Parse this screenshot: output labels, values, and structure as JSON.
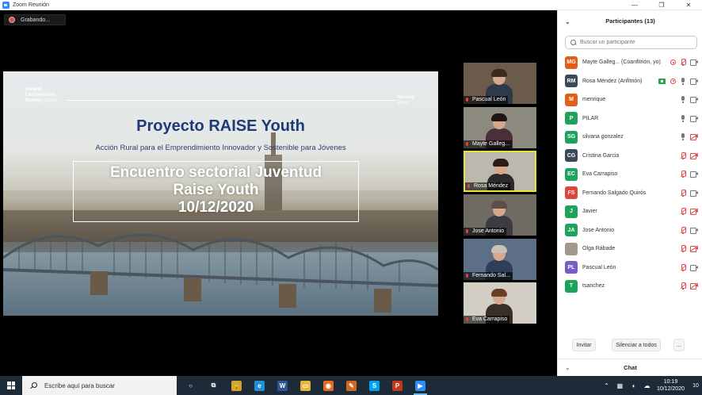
{
  "window": {
    "title": "Zoom Reunión",
    "controls": [
      "—",
      "❐",
      "✕"
    ]
  },
  "recording": {
    "label": "Grabando..."
  },
  "slide": {
    "logo_left": [
      "Iceland",
      "Liechtenstein",
      "Norway"
    ],
    "logo_left_grants": "grants",
    "logo_right": "Norway",
    "logo_right_grants": "grants",
    "title": "Proyecto RAISE Youth",
    "subtitle": "Acción Rural para el Emprendimiento Innovador y Sostenible para Jóvenes",
    "box_lines": [
      "Encuentro sectorial Juventud",
      "Raise Youth",
      "10/12/2020"
    ]
  },
  "videos": [
    {
      "name": "Pascual León",
      "bg": "#6b5b4a",
      "hair": "#3b2a1e",
      "shirt": "#2e3a4a",
      "active": false
    },
    {
      "name": "Mayte Galleg...",
      "bg": "#8d8a80",
      "hair": "#1e1410",
      "shirt": "#4a2f3a",
      "active": false
    },
    {
      "name": "Rosa Méndez",
      "bg": "#bdb8ae",
      "hair": "#2a1c14",
      "shirt": "#2a2a2a",
      "active": true
    },
    {
      "name": "Jose Antonio",
      "bg": "#6f6a62",
      "hair": "#5a5048",
      "shirt": "#3b3b40",
      "active": false
    },
    {
      "name": "Fernando Sal...",
      "bg": "#5c6f86",
      "hair": "#c8c2b8",
      "shirt": "#2f3f5a",
      "active": false
    },
    {
      "name": "Eva Carrapiso",
      "bg": "#d4cfc4",
      "hair": "#6a3e24",
      "shirt": "#3a2e2a",
      "active": false
    }
  ],
  "panel": {
    "title": "Participantes (13)",
    "search_placeholder": "Buscar un participante",
    "participants": [
      {
        "initials": "MG",
        "color": "#e25f1a",
        "name": "Mayte Galleg...",
        "role": "(Coanfitrión, yo)",
        "share": false,
        "rec": true,
        "mic": "muted",
        "cam": "on"
      },
      {
        "initials": "RM",
        "color": "#3a4a5c",
        "name": "Rosa Méndez (Anfitrión)",
        "role": "",
        "share": true,
        "rec": true,
        "mic": "on",
        "cam": "on"
      },
      {
        "initials": "M",
        "color": "#e25f1a",
        "name": "menrique",
        "role": "",
        "share": false,
        "rec": false,
        "mic": "on",
        "cam": "on"
      },
      {
        "initials": "P",
        "color": "#1ea35c",
        "name": "PILAR",
        "role": "",
        "share": false,
        "rec": false,
        "mic": "on",
        "cam": "on"
      },
      {
        "initials": "SG",
        "color": "#1ea35c",
        "name": "silvana gonzalez",
        "role": "",
        "share": false,
        "rec": false,
        "mic": "on",
        "cam": "off"
      },
      {
        "initials": "CG",
        "color": "#3a4a5c",
        "name": "Cristina Garcia",
        "role": "",
        "share": false,
        "rec": false,
        "mic": "muted",
        "cam": "off"
      },
      {
        "initials": "EC",
        "color": "#1ea35c",
        "name": "Eva Carrapiso",
        "role": "",
        "share": false,
        "rec": false,
        "mic": "muted",
        "cam": "on"
      },
      {
        "initials": "FS",
        "color": "#e0453a",
        "name": "Fernando Salgado Quirós",
        "role": "",
        "share": false,
        "rec": false,
        "mic": "muted",
        "cam": "on"
      },
      {
        "initials": "J",
        "color": "#1ea35c",
        "name": "Javier",
        "role": "",
        "share": false,
        "rec": false,
        "mic": "muted",
        "cam": "off"
      },
      {
        "initials": "JA",
        "color": "#1ea35c",
        "name": "Jose Antonio",
        "role": "",
        "share": false,
        "rec": false,
        "mic": "muted",
        "cam": "on"
      },
      {
        "initials": "",
        "color": "#a09a8c",
        "name": "Olga Rábade",
        "role": "",
        "share": false,
        "rec": false,
        "mic": "muted",
        "cam": "off"
      },
      {
        "initials": "PL",
        "color": "#7a5cc9",
        "name": "Pascual León",
        "role": "",
        "share": false,
        "rec": false,
        "mic": "muted",
        "cam": "on"
      },
      {
        "initials": "T",
        "color": "#1ea35c",
        "name": "tsanchez",
        "role": "",
        "share": false,
        "rec": false,
        "mic": "muted",
        "cam": "off"
      }
    ],
    "invite_label": "Invitar",
    "mute_all_label": "Silenciar a todos",
    "more_label": "...",
    "chat_label": "Chat"
  },
  "taskbar": {
    "search_placeholder": "Escribe aquí para buscar",
    "apps": [
      {
        "name": "cortana-icon",
        "glyph": "○",
        "color": "transparent"
      },
      {
        "name": "task-view-icon",
        "glyph": "⧉",
        "color": "transparent"
      },
      {
        "name": "lock-app-icon",
        "glyph": "🔒",
        "color": "#d8a425"
      },
      {
        "name": "edge-icon",
        "glyph": "e",
        "color": "#1f8fd6"
      },
      {
        "name": "word-icon",
        "glyph": "W",
        "color": "#2b5797"
      },
      {
        "name": "file-explorer-icon",
        "glyph": "▭",
        "color": "#e8b73a"
      },
      {
        "name": "firefox-icon",
        "glyph": "◉",
        "color": "#e66b22"
      },
      {
        "name": "app-orange-icon",
        "glyph": "✎",
        "color": "#d2691e"
      },
      {
        "name": "skype-icon",
        "glyph": "S",
        "color": "#00a2ed"
      },
      {
        "name": "powerpoint-icon",
        "glyph": "P",
        "color": "#c4391d"
      },
      {
        "name": "zoom-taskbar-icon",
        "glyph": "▶",
        "color": "#2d8cff"
      }
    ],
    "time": "10:19",
    "date": "10/12/2020",
    "notifications": "10"
  }
}
